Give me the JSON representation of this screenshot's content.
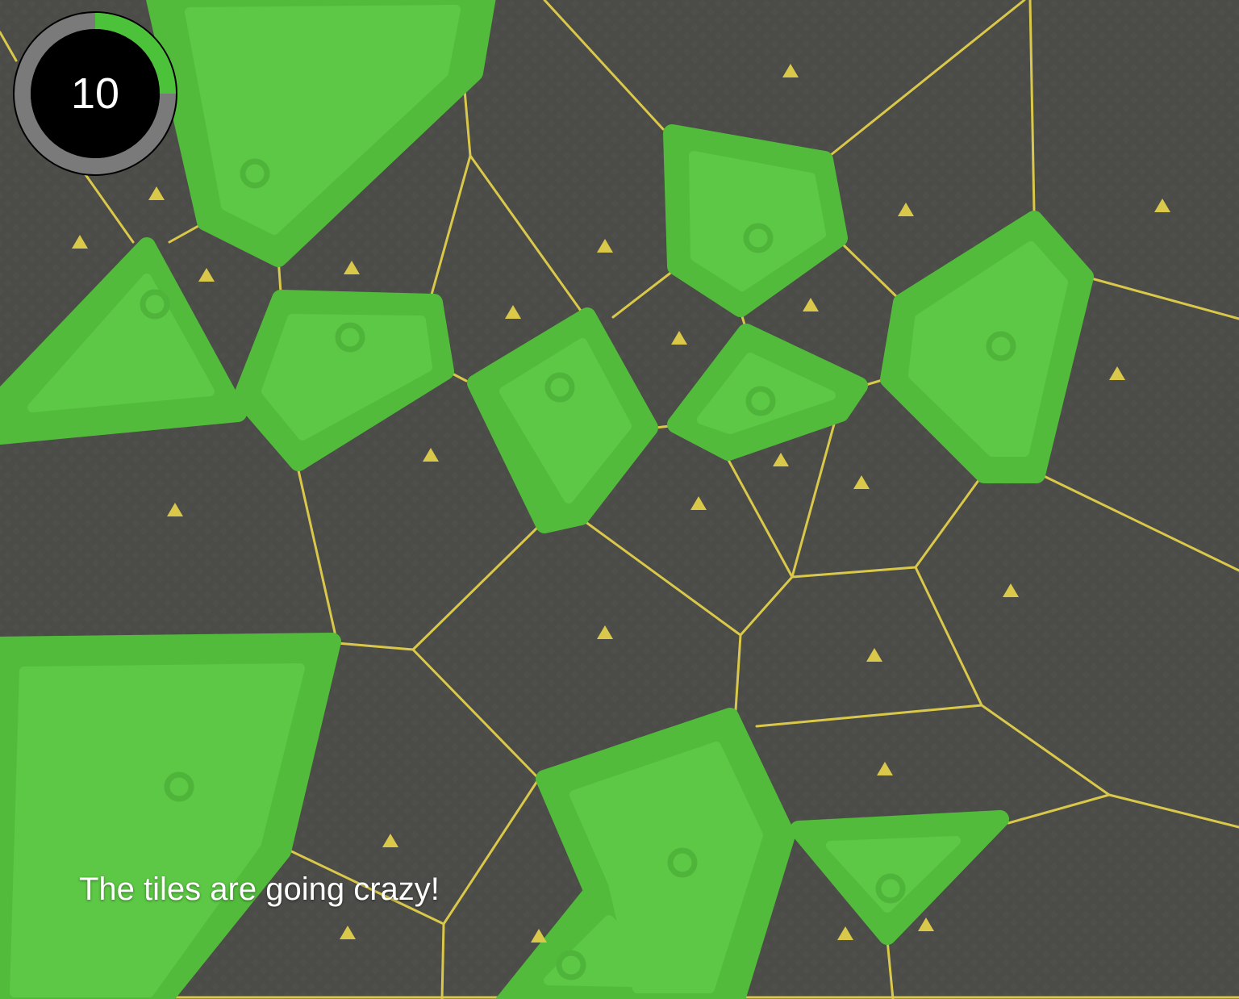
{
  "game": {
    "timer_value": "10",
    "timer_progress": 0.25,
    "message": "The tiles are going crazy!"
  },
  "colors": {
    "background": "#4b4b47",
    "grid_line": "#d9c84a",
    "tile_outer": "#52bb3b",
    "tile_inner": "#5cc845",
    "marker": "#d9c84a",
    "timer_fill": "#000000",
    "timer_ring": "#7a7a7a",
    "timer_progress": "#4cc23a"
  },
  "board": {
    "captured_tile_count": 13,
    "marker_count": 31
  }
}
